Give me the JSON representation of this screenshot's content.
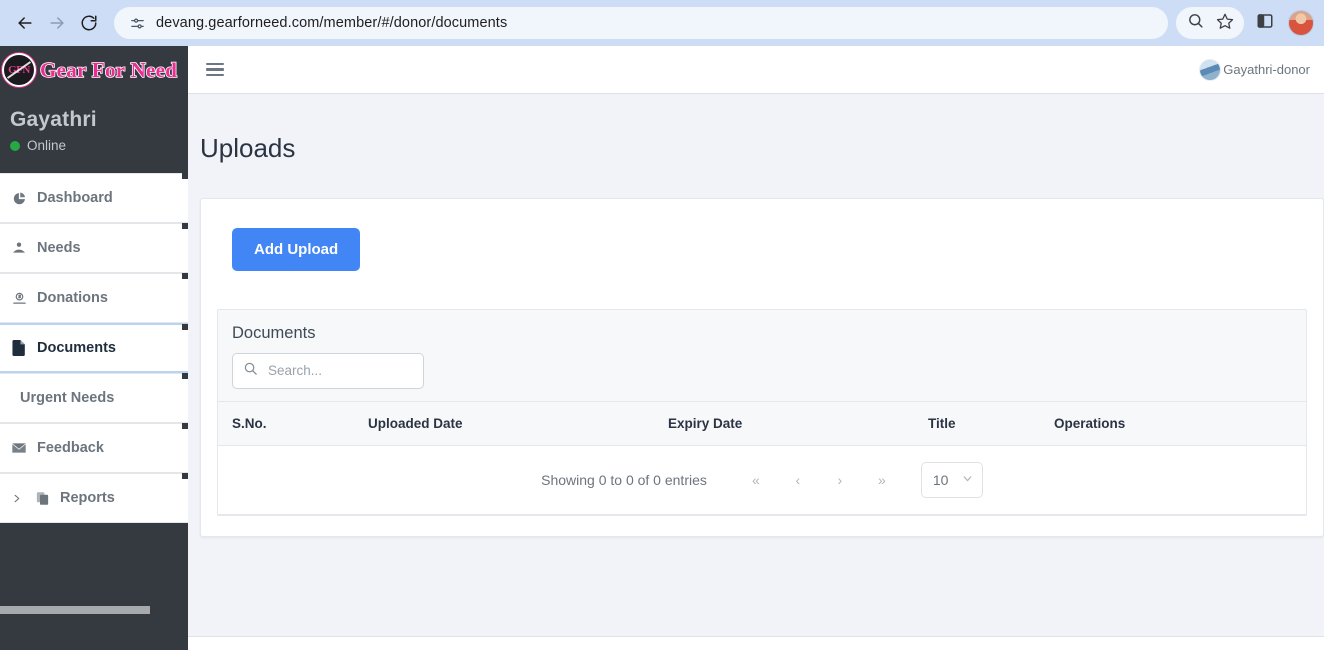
{
  "browser": {
    "url": "devang.gearforneed.com/member/#/donor/documents",
    "back_icon": "back-arrow-icon",
    "forward_icon": "forward-arrow-icon",
    "reload_icon": "reload-icon",
    "site_settings_icon": "site-settings-icon",
    "zoom_icon": "search-icon",
    "bookmark_icon": "star-icon",
    "side_panel_icon": "side-panel-icon",
    "profile_icon": "profile-avatar-icon"
  },
  "sidebar": {
    "brand": {
      "mark": "GFN",
      "text": "Gear For Need"
    },
    "user": {
      "name": "Gayathri",
      "status": "Online",
      "status_color": "#28a745"
    },
    "items": [
      {
        "label": "Dashboard",
        "icon": "pie-chart-icon",
        "active": false,
        "has_icon": true,
        "expandable": false
      },
      {
        "label": "Needs",
        "icon": "hand-holding-heart-icon",
        "active": false,
        "has_icon": true,
        "expandable": false
      },
      {
        "label": "Donations",
        "icon": "donation-money-icon",
        "active": false,
        "has_icon": true,
        "expandable": false
      },
      {
        "label": "Documents",
        "icon": "file-icon",
        "active": true,
        "has_icon": true,
        "expandable": false
      },
      {
        "label": "Urgent Needs",
        "icon": "",
        "active": false,
        "has_icon": false,
        "expandable": false
      },
      {
        "label": "Feedback",
        "icon": "envelope-icon",
        "active": false,
        "has_icon": true,
        "expandable": false
      },
      {
        "label": "Reports",
        "icon": "copy-files-icon",
        "active": false,
        "has_icon": true,
        "expandable": true
      }
    ]
  },
  "topbar": {
    "menu_toggle_icon": "hamburger-menu-icon",
    "user_label": "Gayathri-donor",
    "avatar_icon": "user-avatar-icon"
  },
  "page": {
    "title": "Uploads",
    "add_button_label": "Add Upload",
    "accent_color": "#4285f4"
  },
  "panel": {
    "title": "Documents",
    "search_placeholder": "Search...",
    "search_value": "",
    "search_icon": "search-icon"
  },
  "table": {
    "columns": [
      "S.No.",
      "Uploaded Date",
      "Expiry Date",
      "Title",
      "Operations"
    ],
    "rows": []
  },
  "pagination": {
    "info": "Showing 0 to 0 of 0 entries",
    "first_label": "«",
    "prev_label": "‹",
    "next_label": "›",
    "last_label": "»",
    "page_size": "10",
    "chevron_icon": "chevron-down-icon"
  }
}
